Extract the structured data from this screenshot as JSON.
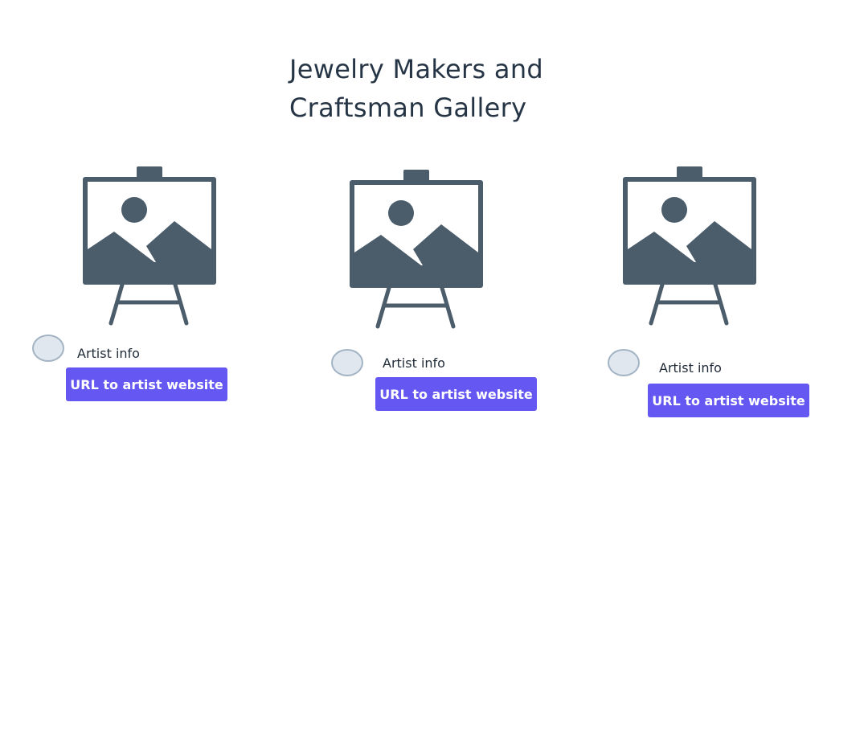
{
  "page": {
    "title": "Jewelry Makers and Craftsman Gallery"
  },
  "artists": [
    {
      "info_label": "Artist info",
      "button_label": "URL to artist website"
    },
    {
      "info_label": "Artist info",
      "button_label": "URL to artist website"
    },
    {
      "info_label": "Artist info",
      "button_label": "URL to artist website"
    }
  ],
  "colors": {
    "icon": "#4b5c6b",
    "button_bg": "#6557f2",
    "button_text": "#ffffff",
    "title_text": "#263545",
    "avatar_fill": "#e0e7ef",
    "avatar_border": "#a3b3c3"
  },
  "icons": {
    "artwork": "easel-picture-icon",
    "avatar": "avatar-placeholder"
  }
}
